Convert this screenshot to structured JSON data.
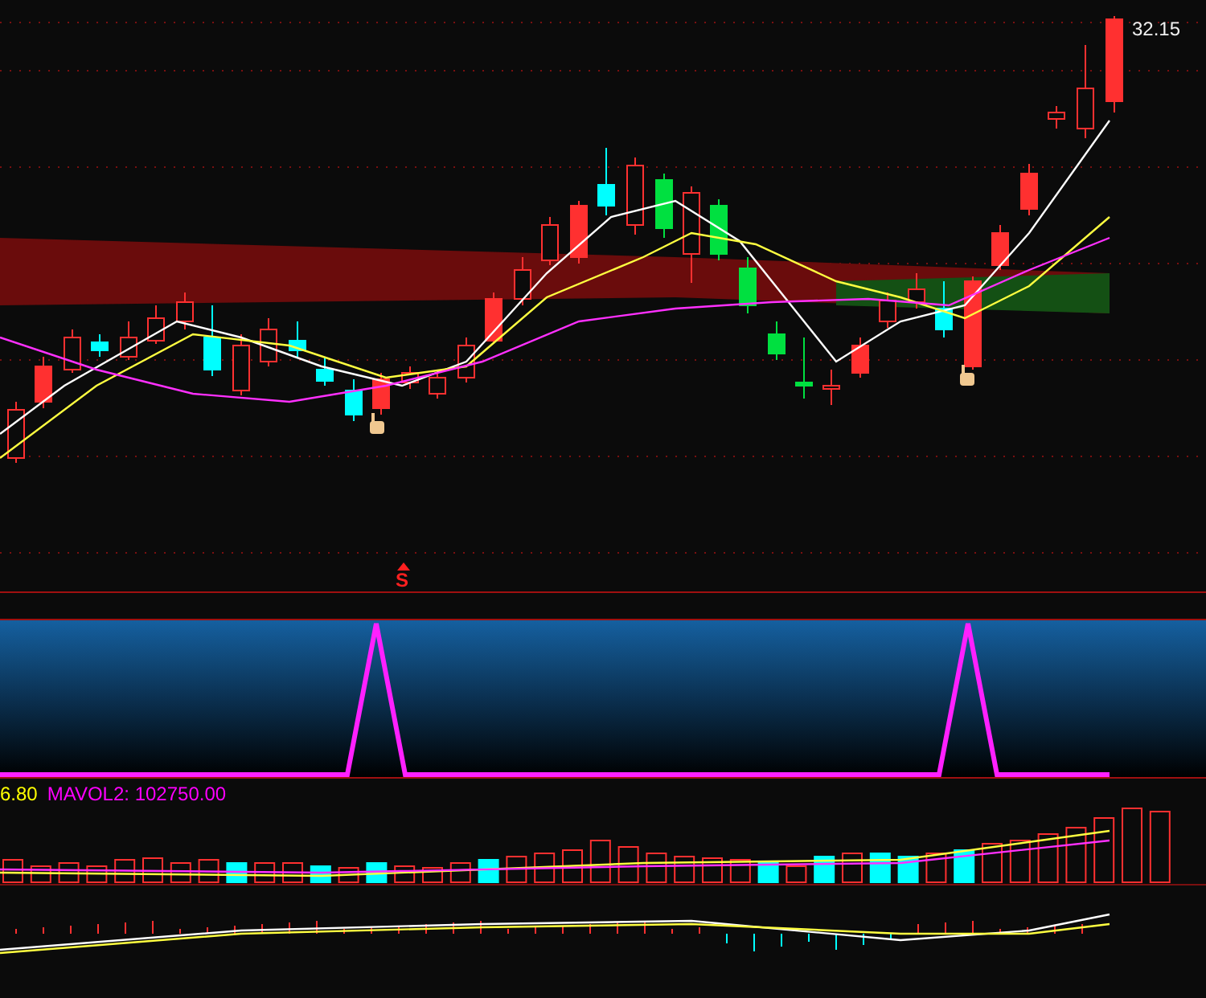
{
  "price_chart": {
    "last_price_label": "32.15"
  },
  "signal_panel": {
    "marker": "S"
  },
  "volume_panel": {
    "legend": [
      {
        "text": "6.80",
        "color": "#ffff00"
      },
      {
        "text": "MAVOL2: 102750.00",
        "color": "#ff00ff"
      }
    ]
  }
}
